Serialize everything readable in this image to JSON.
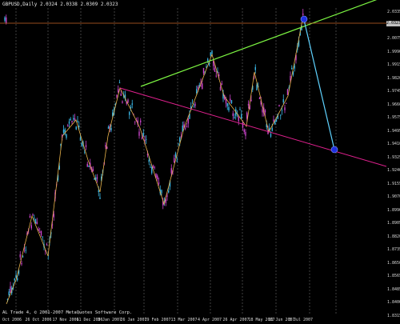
{
  "header": {
    "title": "GBPUSD,Daily 2.0324 2.0338 2.0309 2.0323"
  },
  "footer": {
    "copyright": "AL Trade 4, © 2001-2007 MetaQuotes Software Corp."
  },
  "price_axis": {
    "current_price": "2.0323",
    "labels": [
      "2.0335",
      "2.0125",
      "2.0075",
      "1.9990",
      "1.9915",
      "1.9820",
      "1.9745",
      "1.9660",
      "1.9575",
      "1.9495",
      "1.9410",
      "1.9325",
      "1.9240",
      "1.9155",
      "1.9070",
      "1.8990",
      "1.8905",
      "1.8820",
      "1.8735",
      "1.8650",
      "1.8565",
      "1.8485",
      "1.8400",
      "1.8315"
    ]
  },
  "time_axis": {
    "labels": [
      "4 Oct 2006",
      "26 Oct 2006",
      "17 Nov 2006",
      "11 Dec 2006",
      "3 Jan 2007",
      "26 Jan 2007",
      "19 Feb 2007",
      "13 Mar 2007",
      "4 Apr 2007",
      "26 Apr 2007",
      "18 May 2007",
      "11 Jun 2007",
      "3 Jul 2007"
    ]
  },
  "colors": {
    "background": "#000000",
    "grid": "#6a6a6a",
    "candle_up": "#3ab7e6",
    "candle_down": "#cc44cc",
    "zigzag": "#e8b24a",
    "upper_channel": "#7cf542",
    "lower_channel": "#e0208e",
    "projection": "#5fd3ff",
    "current_price_line": "#c86428",
    "marker": "#2030e0"
  }
}
